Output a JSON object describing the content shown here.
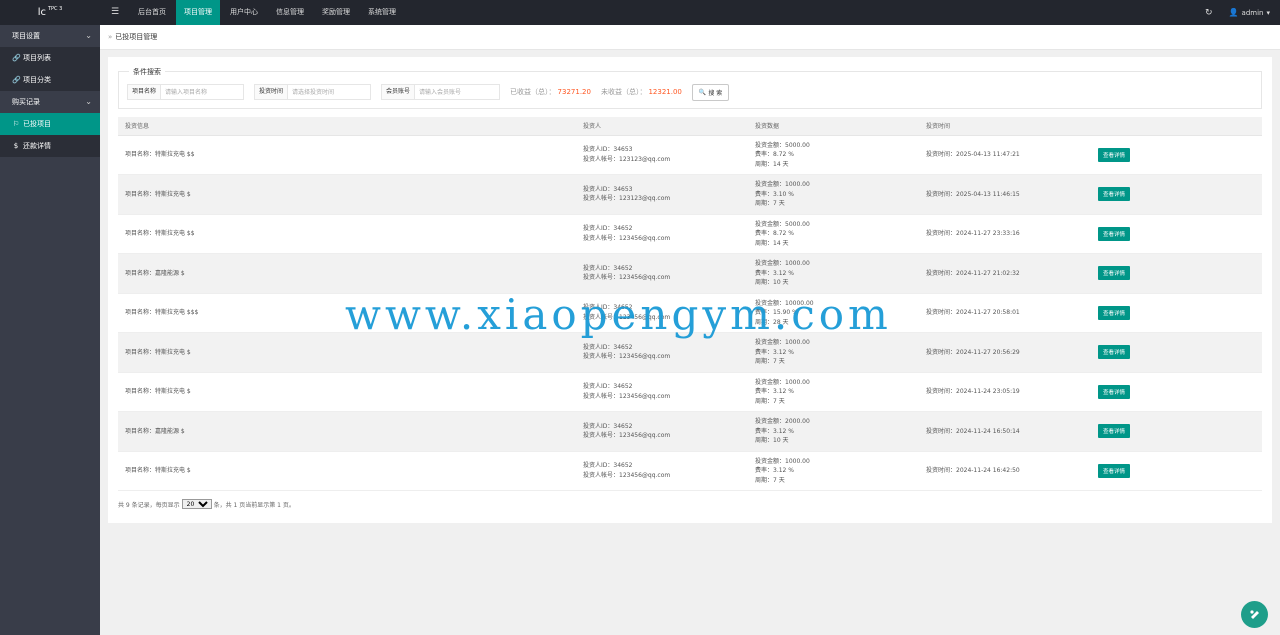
{
  "app": {
    "logo": "lc",
    "logo_sup": "TPC 3"
  },
  "topnav": [
    "后台首页",
    "项目管理",
    "用户中心",
    "信息管理",
    "奖励管理",
    "系统管理"
  ],
  "user": {
    "name": "admin"
  },
  "sidebar": {
    "groups": [
      {
        "label": "项目设置",
        "items": [
          "项目列表",
          "项目分类"
        ]
      },
      {
        "label": "购买记录",
        "items": [
          "已投项目",
          "还款详情"
        ]
      }
    ]
  },
  "breadcrumb": "已投项目管理",
  "filter": {
    "title": "条件搜索",
    "project_label": "项目名称",
    "project_placeholder": "请输入项目名称",
    "time_label": "投资时间",
    "time_placeholder": "请选择投资时间",
    "member_label": "会员账号",
    "member_placeholder": "请输入会员账号",
    "earned_label": "已收益（总）：",
    "earned_value": "73271.20",
    "pending_label": "未收益（总）：",
    "pending_value": "12321.00",
    "search_label": "搜 索"
  },
  "table": {
    "headers": [
      "投资信息",
      "投资人",
      "投资数据",
      "投资时间",
      ""
    ],
    "detail_label": "查看详情",
    "rows": [
      {
        "project": "项目名称：特斯拉充电 $$",
        "uid": "投资人ID：34653",
        "account": "投资人帐号：123123@qq.com",
        "amount": "投资金额：5000.00",
        "rate": "费率：8.72 %",
        "period": "周期：14 天",
        "time": "投资时间：2025-04-13 11:47:21"
      },
      {
        "project": "项目名称：特斯拉充电 $",
        "uid": "投资人ID：34653",
        "account": "投资人帐号：123123@qq.com",
        "amount": "投资金额：1000.00",
        "rate": "费率：3.10 %",
        "period": "周期：7 天",
        "time": "投资时间：2025-04-13 11:46:15"
      },
      {
        "project": "项目名称：特斯拉充电 $$",
        "uid": "投资人ID：34652",
        "account": "投资人帐号：123456@qq.com",
        "amount": "投资金额：5000.00",
        "rate": "费率：8.72 %",
        "period": "周期：14 天",
        "time": "投资时间：2024-11-27 23:33:16"
      },
      {
        "project": "项目名称：嘉隆能源 $",
        "uid": "投资人ID：34652",
        "account": "投资人帐号：123456@qq.com",
        "amount": "投资金额：1000.00",
        "rate": "费率：3.12 %",
        "period": "周期：10 天",
        "time": "投资时间：2024-11-27 21:02:32"
      },
      {
        "project": "项目名称：特斯拉充电 $$$",
        "uid": "投资人ID：34652",
        "account": "投资人帐号：123456@qq.com",
        "amount": "投资金额：10000.00",
        "rate": "费率：15.90 %",
        "period": "周期：28 天",
        "time": "投资时间：2024-11-27 20:58:01"
      },
      {
        "project": "项目名称：特斯拉充电 $",
        "uid": "投资人ID：34652",
        "account": "投资人帐号：123456@qq.com",
        "amount": "投资金额：1000.00",
        "rate": "费率：3.12 %",
        "period": "周期：7 天",
        "time": "投资时间：2024-11-27 20:56:29"
      },
      {
        "project": "项目名称：特斯拉充电 $",
        "uid": "投资人ID：34652",
        "account": "投资人帐号：123456@qq.com",
        "amount": "投资金额：1000.00",
        "rate": "费率：3.12 %",
        "period": "周期：7 天",
        "time": "投资时间：2024-11-24 23:05:19"
      },
      {
        "project": "项目名称：嘉隆能源 $",
        "uid": "投资人ID：34652",
        "account": "投资人帐号：123456@qq.com",
        "amount": "投资金额：2000.00",
        "rate": "费率：3.12 %",
        "period": "周期：10 天",
        "time": "投资时间：2024-11-24 16:50:14"
      },
      {
        "project": "项目名称：特斯拉充电 $",
        "uid": "投资人ID：34652",
        "account": "投资人帐号：123456@qq.com",
        "amount": "投资金额：1000.00",
        "rate": "费率：3.12 %",
        "period": "周期：7 天",
        "time": "投资时间：2024-11-24 16:42:50"
      }
    ]
  },
  "pager": {
    "prefix": "共 9 条记录，每页显示",
    "per_page": "20",
    "suffix": "条，共 1 页当前显示第 1 页。"
  },
  "watermark": "www.xiaopengym.com",
  "colors": {
    "accent": "#009688",
    "amount": "#ff5722",
    "topbar": "#23262e",
    "sidebar": "#393d49"
  }
}
